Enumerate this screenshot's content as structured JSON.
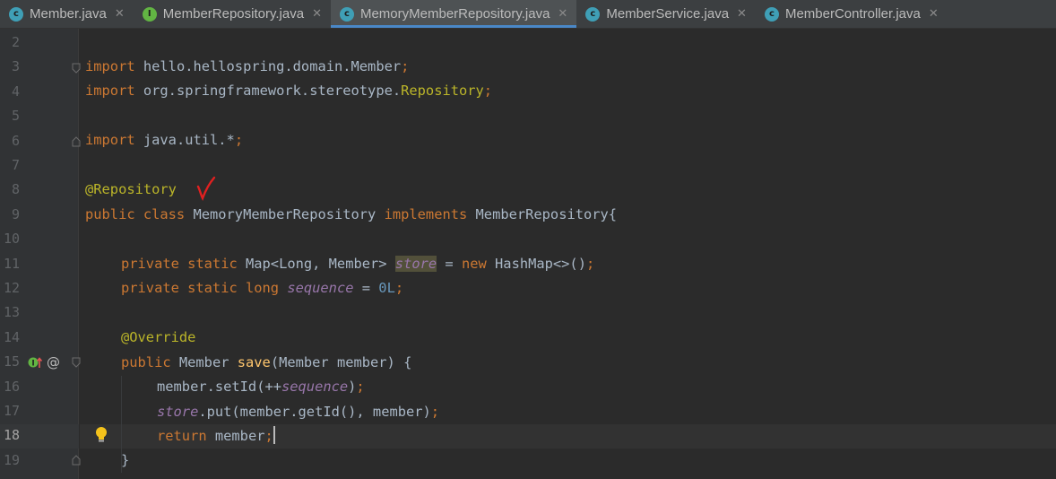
{
  "tabs": [
    {
      "label": "Member.java",
      "icon": "class-icon",
      "icon_letter": "c",
      "icon_color": "#3f9fb6",
      "active": false
    },
    {
      "label": "MemberRepository.java",
      "icon": "interface-icon",
      "icon_letter": "I",
      "icon_color": "#62b543",
      "active": false
    },
    {
      "label": "MemoryMemberRepository.java",
      "icon": "class-icon",
      "icon_letter": "c",
      "icon_color": "#3f9fb6",
      "active": true
    },
    {
      "label": "MemberService.java",
      "icon": "class-icon",
      "icon_letter": "c",
      "icon_color": "#3f9fb6",
      "active": false
    },
    {
      "label": "MemberController.java",
      "icon": "class-icon",
      "icon_letter": "c",
      "icon_color": "#3f9fb6",
      "active": false
    }
  ],
  "close_glyph": "✕",
  "line_numbers": [
    "2",
    "3",
    "4",
    "5",
    "6",
    "7",
    "8",
    "9",
    "10",
    "11",
    "12",
    "13",
    "14",
    "15",
    "16",
    "17",
    "18",
    "19"
  ],
  "current_line": "18",
  "code": {
    "l3": {
      "kw": "import",
      "rest": " hello.hellospring.domain.Member",
      "semi": ";"
    },
    "l4": {
      "kw": "import",
      "pkg": " org.springframework.stereotype.",
      "cls": "Repository",
      "semi": ";"
    },
    "l6": {
      "kw": "import",
      "rest": " java.util.*",
      "semi": ";"
    },
    "l8": {
      "ann": "@Repository"
    },
    "l9": {
      "kw1": "public class",
      "name": " MemoryMemberRepository ",
      "kw2": "implements",
      "rest": " MemberRepository{"
    },
    "l11": {
      "kw": "private static",
      "type": " Map<Long, Member> ",
      "field": "store",
      "eq": " = ",
      "kw2": "new",
      "rest": " HashMap<>()",
      "semi": ";"
    },
    "l12": {
      "kw": "private static long",
      "sp": " ",
      "field": "sequence",
      "eq": " = ",
      "num": "0L",
      "semi": ";"
    },
    "l14": {
      "ann": "@Override"
    },
    "l15": {
      "kw": "public",
      "type": " Member ",
      "fn": "save",
      "rest": "(Member member) {"
    },
    "l16": {
      "pre": "member.setId(++",
      "field": "sequence",
      "post": ")",
      "semi": ";"
    },
    "l17": {
      "field": "store",
      "post": ".put(member.getId(), member)",
      "semi": ";"
    },
    "l18": {
      "kw": "return",
      "rest": " member",
      "semi": ";"
    },
    "l19": {
      "rest": "}"
    }
  },
  "gutter_markers": {
    "at_symbol": "@"
  },
  "colors": {
    "keyword": "#cc7832",
    "annotation": "#bbb529",
    "function": "#ffc66d",
    "number": "#6897bb",
    "field": "#9876aa",
    "text": "#a9b7c6",
    "background": "#2b2b2b",
    "handwritten_check": "#e02020"
  }
}
